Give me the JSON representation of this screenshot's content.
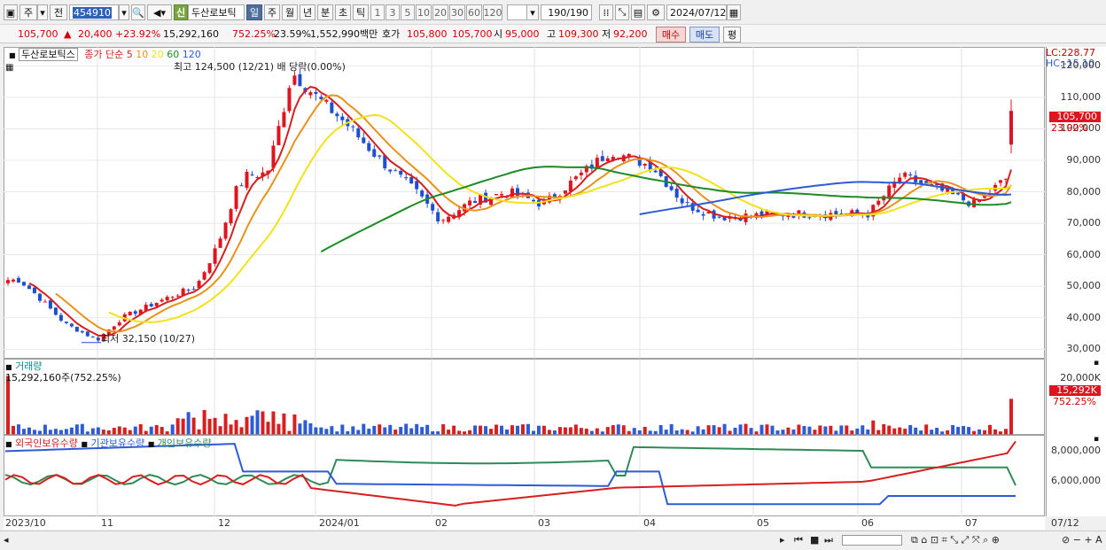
{
  "toolbar": {
    "market": "주",
    "prev": "전",
    "code": "454910",
    "credit_badge": "신",
    "name": "두산로보틱",
    "periods": [
      "일",
      "주",
      "월",
      "년",
      "분",
      "초",
      "틱"
    ],
    "active_period": "일",
    "intervals": [
      "1",
      "3",
      "5",
      "10",
      "20",
      "30",
      "60",
      "120"
    ],
    "count": "190",
    "count_total": "/190",
    "date": "2024/07/12"
  },
  "quote": {
    "price": "105,700",
    "change": "20,400",
    "change_pct": "+23.92%",
    "volume": "15,292,160",
    "vol_ratio": "752.25%",
    "turnover": "23.59%",
    "amount": "1,552,990백만",
    "bid_label": "호가",
    "bid": "105,800",
    "ask": "105,700",
    "open_label": "시",
    "open": "95,000",
    "high_label": "고",
    "high": "109,300",
    "low_label": "저",
    "low": "92,200",
    "buy_btn": "매수",
    "sell_btn": "매도",
    "eval_btn": "평"
  },
  "price_panel": {
    "stock_label": "두산로보틱스",
    "ma_title": "종가 단순",
    "ma_periods": [
      "5",
      "10",
      "20",
      "60",
      "120"
    ],
    "ma_colors": [
      "#d81e1e",
      "#e89219",
      "#f2e21a",
      "#1d8b26",
      "#2d5bd6"
    ],
    "high_note": "최고 124,500 (12/21) 배 당락(0.00%)",
    "low_note": "최저 32,150 (10/27)",
    "lc": "LC:228.77",
    "hc": "HC:-15.10",
    "last_price": "105,700",
    "last_pct": "23.92%",
    "y_labels": [
      "120,000",
      "110,000",
      "100,000",
      "90,000",
      "80,000",
      "70,000",
      "60,000",
      "50,000",
      "40,000",
      "30,000"
    ]
  },
  "volume_panel": {
    "title": "거래량",
    "value": "15,292,160주(752.25%)",
    "y_label": "20,000K",
    "tag": "15,292K",
    "tag_pct": "752.25%"
  },
  "holding_panel": {
    "foreign": "외국인보유수량",
    "inst": "기관보유수량",
    "indiv": "개인보유수량",
    "colors": [
      "#d81e1e",
      "#2d5bd6",
      "#2e8b57"
    ],
    "y_labels": [
      "8,000,000",
      "6,000,000"
    ]
  },
  "x_labels": [
    "2023/10",
    "11",
    "12",
    "2024/01",
    "02",
    "03",
    "04",
    "05",
    "06",
    "07"
  ],
  "x_end": "07/12",
  "chart_data": {
    "type": "candlestick",
    "y_range": [
      27000,
      126000
    ],
    "y_ticks": [
      120000,
      110000,
      100000,
      90000,
      80000,
      70000,
      60000,
      50000,
      40000,
      30000
    ],
    "series": [
      {
        "name": "종가 단순 5",
        "color": "#d81e1e"
      },
      {
        "name": "10",
        "color": "#e89219"
      },
      {
        "name": "20",
        "color": "#f2e21a"
      },
      {
        "name": "60",
        "color": "#1d8b26"
      },
      {
        "name": "120",
        "color": "#2d5bd6"
      }
    ],
    "close_path": [
      [
        "2023/10/05",
        52000
      ],
      [
        "2023/10/10",
        47000
      ],
      [
        "2023/10/18",
        38000
      ],
      [
        "2023/10/27",
        33000
      ],
      [
        "2023/11/03",
        40000
      ],
      [
        "2023/11/15",
        46000
      ],
      [
        "2023/11/24",
        50000
      ],
      [
        "2023/11/30",
        63000
      ],
      [
        "2023/12/05",
        80000
      ],
      [
        "2023/12/08",
        85000
      ],
      [
        "2023/12/14",
        86000
      ],
      [
        "2023/12/19",
        108000
      ],
      [
        "2023/12/21",
        118000
      ],
      [
        "2023/12/28",
        110000
      ],
      [
        "2024/01/05",
        102000
      ],
      [
        "2024/01/15",
        90000
      ],
      [
        "2024/01/25",
        80000
      ],
      [
        "2024/02/01",
        71000
      ],
      [
        "2024/02/10",
        77000
      ],
      [
        "2024/02/20",
        80000
      ],
      [
        "2024/03/01",
        76000
      ],
      [
        "2024/03/10",
        84000
      ],
      [
        "2024/03/20",
        93000
      ],
      [
        "2024/04/01",
        88000
      ],
      [
        "2024/04/10",
        76000
      ],
      [
        "2024/04/20",
        72000
      ],
      [
        "2024/05/10",
        73000
      ],
      [
        "2024/06/01",
        73000
      ],
      [
        "2024/06/10",
        85000
      ],
      [
        "2024/06/20",
        81000
      ],
      [
        "2024/07/01",
        76000
      ],
      [
        "2024/07/11",
        85300
      ],
      [
        "2024/07/12",
        105700
      ]
    ]
  }
}
